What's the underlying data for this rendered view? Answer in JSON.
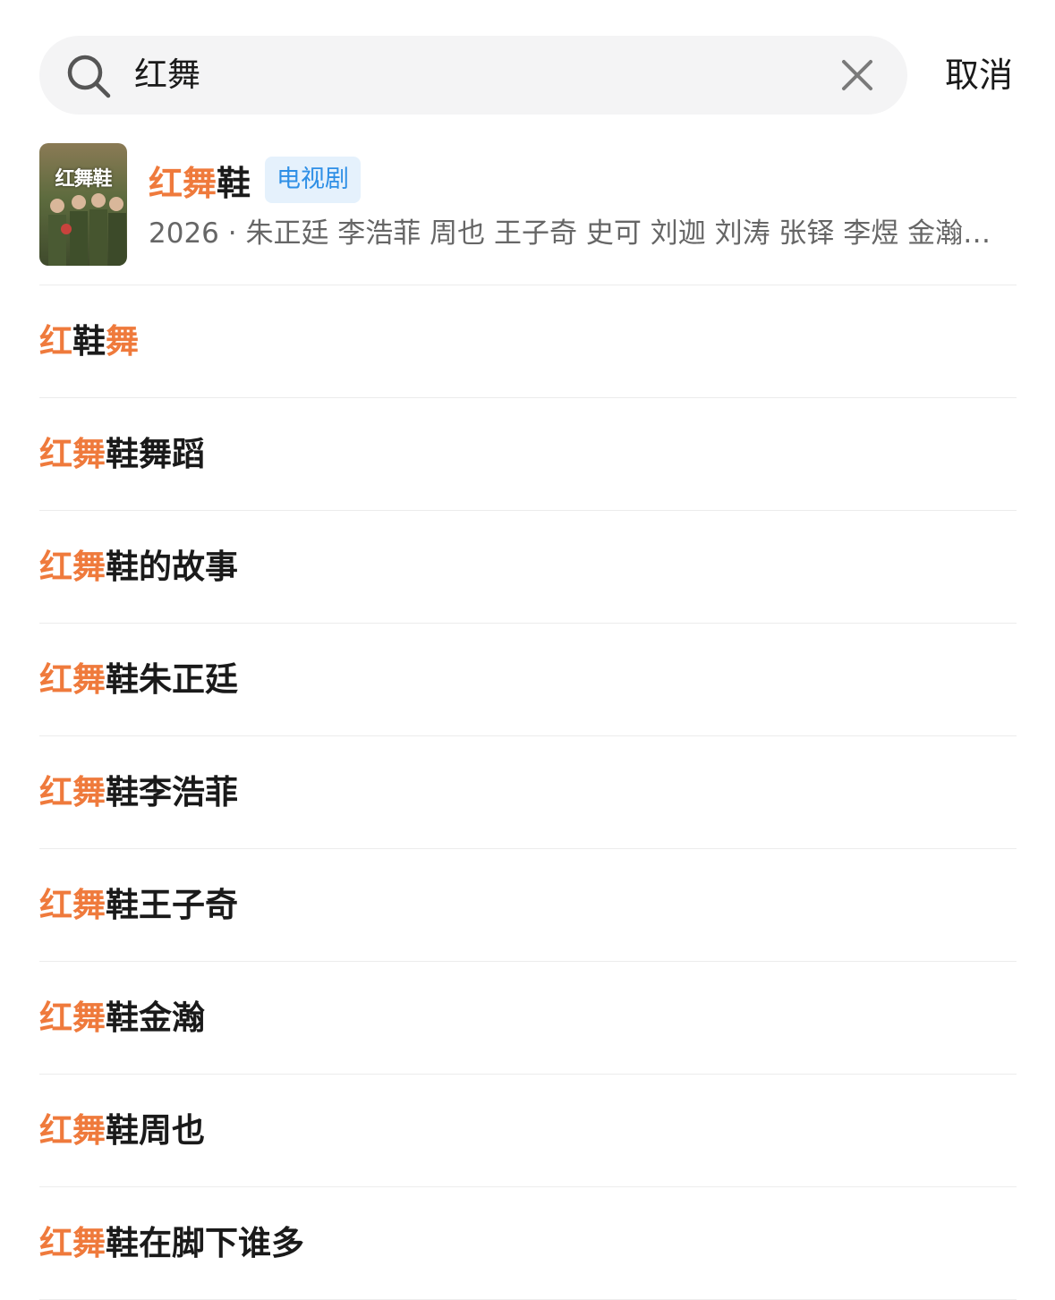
{
  "search": {
    "query": "红舞",
    "cancel_label": "取消"
  },
  "result_card": {
    "poster_text": "红舞鞋",
    "title_parts": [
      {
        "text": "红舞",
        "highlight": true
      },
      {
        "text": "鞋",
        "highlight": false
      }
    ],
    "badge": "电视剧",
    "meta": "2026 · 朱正廷 李浩菲 周也 王子奇 史可 刘迦 刘涛 张铎 李煜 金瀚…"
  },
  "suggestions": [
    [
      {
        "text": "红",
        "highlight": true
      },
      {
        "text": "鞋",
        "highlight": false
      },
      {
        "text": "舞",
        "highlight": true
      }
    ],
    [
      {
        "text": "红舞",
        "highlight": true
      },
      {
        "text": "鞋舞蹈",
        "highlight": false
      }
    ],
    [
      {
        "text": "红舞",
        "highlight": true
      },
      {
        "text": "鞋的故事",
        "highlight": false
      }
    ],
    [
      {
        "text": "红舞",
        "highlight": true
      },
      {
        "text": "鞋朱正廷",
        "highlight": false
      }
    ],
    [
      {
        "text": "红舞",
        "highlight": true
      },
      {
        "text": "鞋李浩菲",
        "highlight": false
      }
    ],
    [
      {
        "text": "红舞",
        "highlight": true
      },
      {
        "text": "鞋王子奇",
        "highlight": false
      }
    ],
    [
      {
        "text": "红舞",
        "highlight": true
      },
      {
        "text": "鞋金瀚",
        "highlight": false
      }
    ],
    [
      {
        "text": "红舞",
        "highlight": true
      },
      {
        "text": "鞋周也",
        "highlight": false
      }
    ],
    [
      {
        "text": "红舞",
        "highlight": true
      },
      {
        "text": "鞋在脚下谁多",
        "highlight": false
      }
    ]
  ],
  "colors": {
    "highlight": "#ef7a3c",
    "badge_text": "#2e8fe6",
    "badge_bg": "#e5f1fc",
    "search_bg": "#f4f4f5"
  },
  "icons": {
    "search": "search-icon",
    "clear": "close-icon"
  }
}
